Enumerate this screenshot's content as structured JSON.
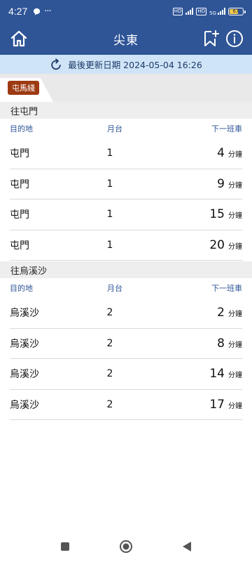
{
  "status_bar": {
    "time": "4:27",
    "battery": "67"
  },
  "app_bar": {
    "title": "尖東"
  },
  "update": {
    "text": "最後更新日期 2024-05-04 16:26"
  },
  "line_tab": {
    "label": "屯馬綫",
    "color": "#9c3a12"
  },
  "columns": {
    "destination": "目的地",
    "platform": "月台",
    "next_train": "下一班車"
  },
  "minute_unit": "分鐘",
  "sections": [
    {
      "header": "往屯門",
      "rows": [
        {
          "destination": "屯門",
          "platform": "1",
          "minutes": "4"
        },
        {
          "destination": "屯門",
          "platform": "1",
          "minutes": "9"
        },
        {
          "destination": "屯門",
          "platform": "1",
          "minutes": "15"
        },
        {
          "destination": "屯門",
          "platform": "1",
          "minutes": "20"
        }
      ]
    },
    {
      "header": "往烏溪沙",
      "rows": [
        {
          "destination": "烏溪沙",
          "platform": "2",
          "minutes": "2"
        },
        {
          "destination": "烏溪沙",
          "platform": "2",
          "minutes": "8"
        },
        {
          "destination": "烏溪沙",
          "platform": "2",
          "minutes": "14"
        },
        {
          "destination": "烏溪沙",
          "platform": "2",
          "minutes": "17"
        }
      ]
    }
  ],
  "colors": {
    "primary": "#2f5597",
    "update_bg": "#cfe4f6"
  }
}
